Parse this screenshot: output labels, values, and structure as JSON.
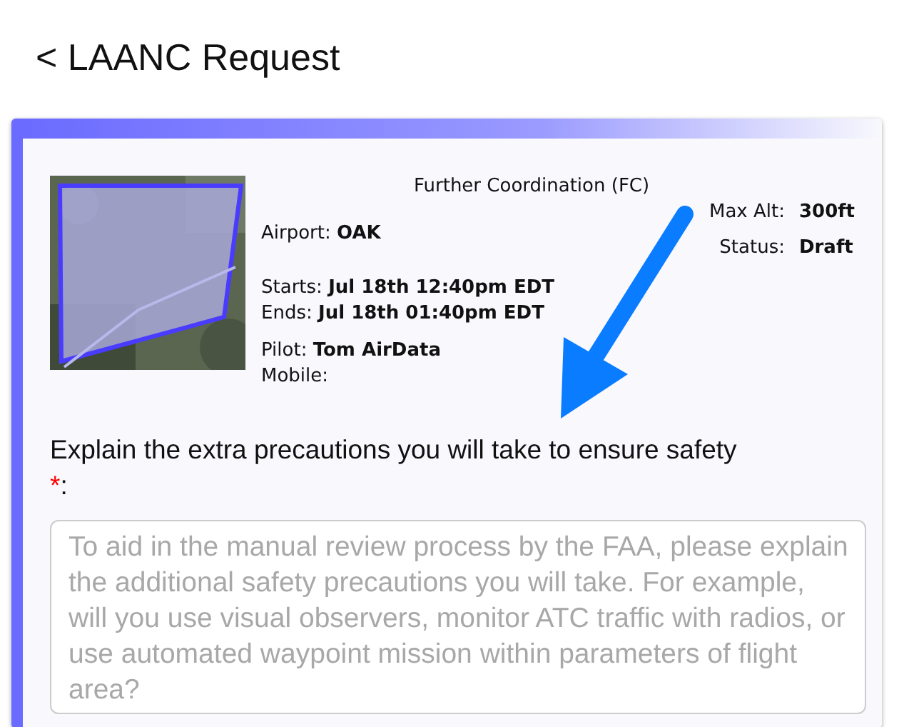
{
  "header": {
    "title": "< LAANC Request"
  },
  "request": {
    "type": "Further Coordination (FC)",
    "left_groups": [
      [
        {
          "label": "Airport:",
          "value": "OAK"
        }
      ],
      [
        {
          "label": "Starts:",
          "value": "Jul 18th 12:40pm EDT"
        },
        {
          "label": "Ends:",
          "value": "Jul 18th 01:40pm EDT"
        }
      ],
      [
        {
          "label": "Pilot:",
          "value": "Tom AirData"
        },
        {
          "label": "Mobile:"
        }
      ]
    ],
    "right_fields": [
      {
        "label": "Max Alt:",
        "value": "300ft"
      },
      {
        "label": "Status:",
        "value": "Draft"
      }
    ]
  },
  "question": {
    "label": "Explain the extra precautions you will take to ensure safety",
    "required_mark": "*",
    "colon": ":",
    "placeholder": "To aid in the manual review process by the FAA, please explain the additional safety precautions you will take. For example, will you use visual observers, monitor ATC traffic with radios, or use automated waypoint mission within parameters of flight area?"
  }
}
